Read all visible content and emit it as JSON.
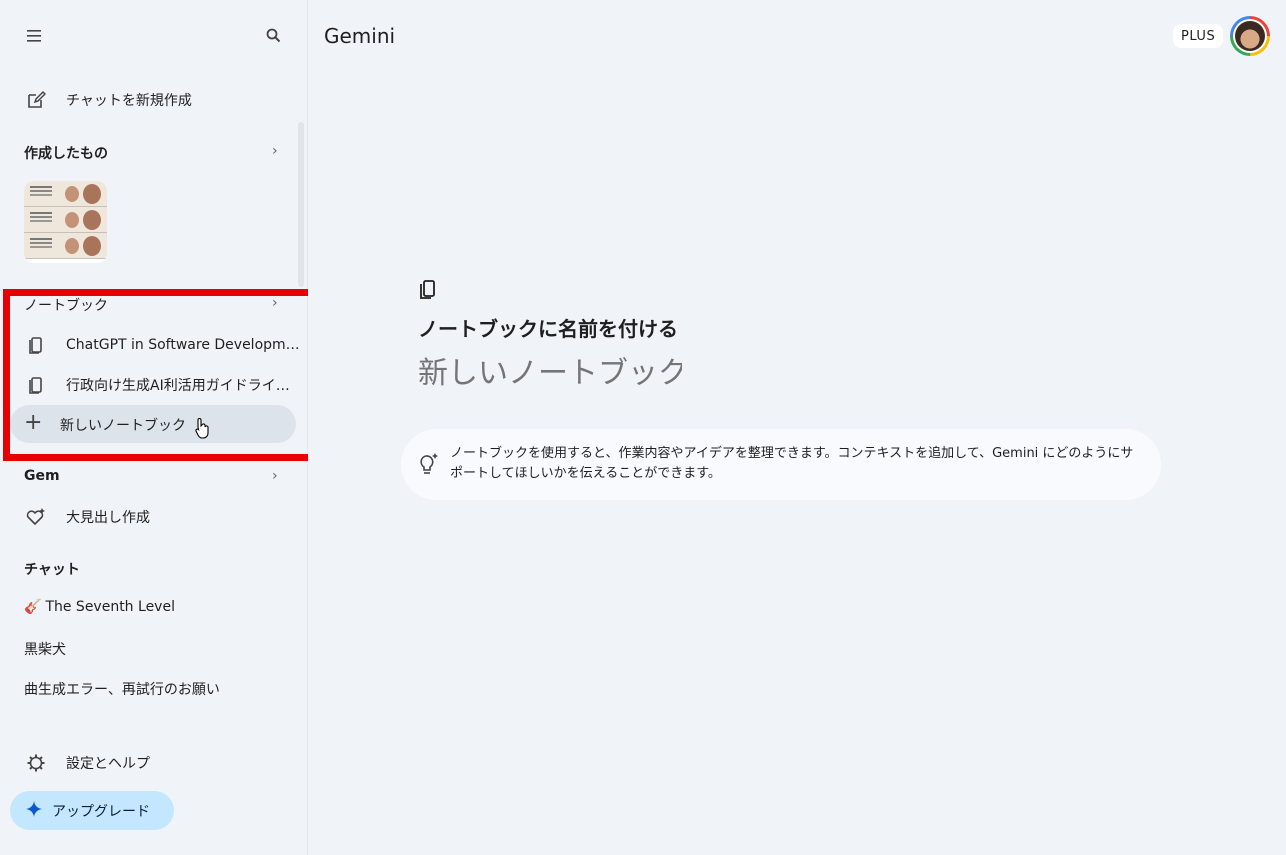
{
  "app": {
    "title": "Gemini"
  },
  "sidebar": {
    "new_chat": "チャットを新規作成",
    "created_section": "作成したもの",
    "notebook_section": "ノートブック",
    "notebooks": [
      {
        "label": "ChatGPT in Software Developm…"
      },
      {
        "label": "行政向け生成AI利活用ガイドライ…"
      }
    ],
    "new_notebook": "新しいノートブック",
    "gem_section": "Gem",
    "gems": [
      {
        "label": "大見出し作成"
      }
    ],
    "chat_section": "チャット",
    "chats": [
      {
        "label": "The Seventh Level",
        "emoji": "🎸"
      },
      {
        "label": "黒柴犬"
      },
      {
        "label": "曲生成エラー、再試行のお願い"
      }
    ],
    "settings": "設定とヘルプ",
    "upgrade": "アップグレード"
  },
  "header": {
    "plan_badge": "PLUS"
  },
  "main": {
    "heading": "ノートブックに名前を付ける",
    "name_input_placeholder": "新しいノートブック",
    "info": "ノートブックを使用すると、作業内容やアイデアを整理できます。コンテキストを追加して、Gemini にどのようにサポートしてほしいかを伝えることができます。"
  },
  "colors": {
    "highlight_border": "#e60000",
    "upgrade_bg": "#c2e7ff",
    "page_bg": "#f0f4f9"
  }
}
